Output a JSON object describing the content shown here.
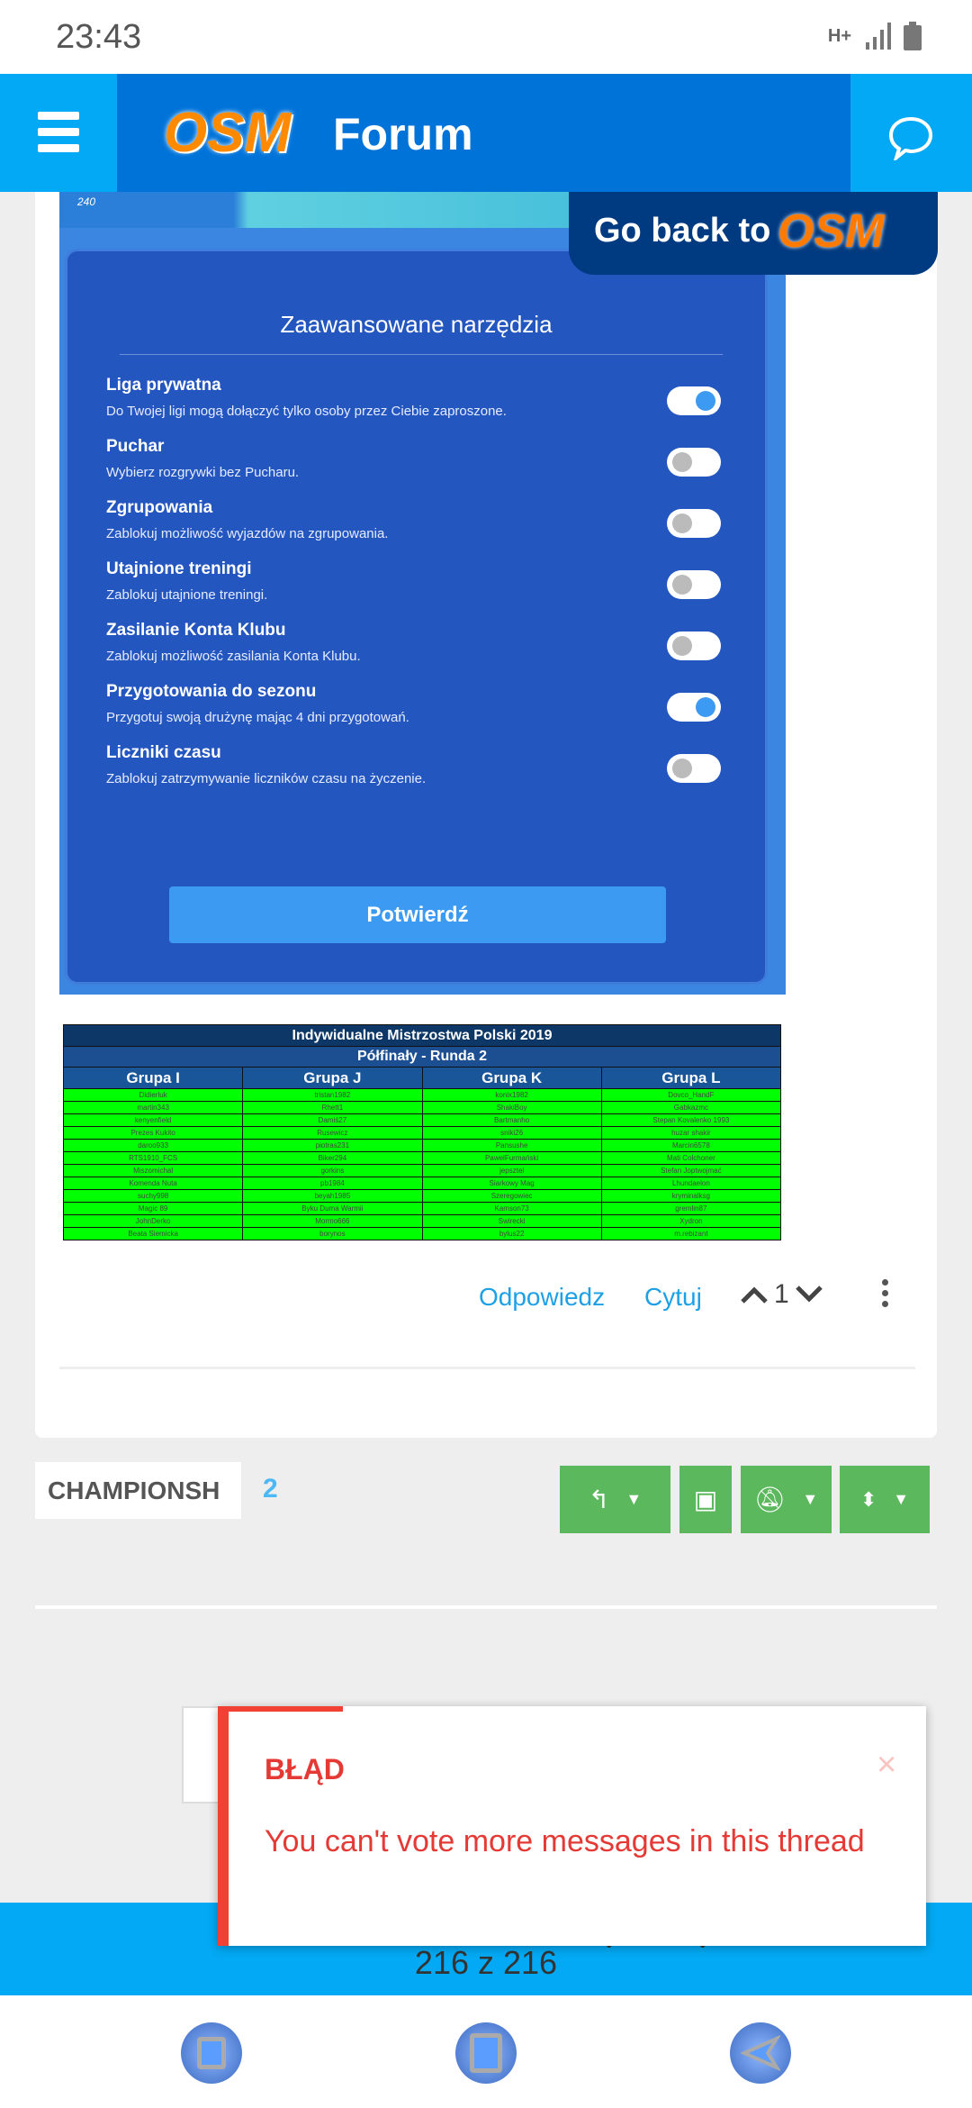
{
  "status": {
    "time": "23:43",
    "network": "H+",
    "icons": [
      "network-type-icon",
      "signal-icon",
      "battery-icon"
    ]
  },
  "header": {
    "logo": "OSM",
    "title": "Forum",
    "icons": [
      "menu-icon",
      "chat-icon"
    ]
  },
  "banner": {
    "go_back": "Go back to",
    "logo": "OSM",
    "strip_value": "240"
  },
  "settings": {
    "title": "Zaawansowane narzędzia",
    "items": [
      {
        "label": "Liga prywatna",
        "desc": "Do Twojej ligi mogą dołączyć tylko osoby przez Ciebie zaproszone.",
        "on": true
      },
      {
        "label": "Puchar",
        "desc": "Wybierz rozgrywki bez Pucharu.",
        "on": false
      },
      {
        "label": "Zgrupowania",
        "desc": "Zablokuj możliwość wyjazdów na zgrupowania.",
        "on": false
      },
      {
        "label": "Utajnione treningi",
        "desc": "Zablokuj utajnione treningi.",
        "on": false
      },
      {
        "label": "Zasilanie Konta Klubu",
        "desc": "Zablokuj możliwość zasilania Konta Klubu.",
        "on": false
      },
      {
        "label": "Przygotowania do sezonu",
        "desc": "Przygotuj swoją drużynę mając 4 dni przygotowań.",
        "on": true
      },
      {
        "label": "Liczniki czasu",
        "desc": "Zablokuj zatrzymywanie liczników czasu na życzenie.",
        "on": false
      }
    ],
    "confirm": "Potwierdź"
  },
  "table": {
    "title": "Indywidualne Mistrzostwa Polski 2019",
    "subtitle": "Półfinały - Runda 2",
    "headers": [
      "Grupa I",
      "Grupa J",
      "Grupa K",
      "Grupa L"
    ],
    "rows": [
      [
        "Didierluk",
        "tristan1982",
        "konix1982",
        "Dovco_HandF"
      ],
      [
        "martin343",
        "Rhett1",
        "ShakiBoy",
        "Gabkazmc"
      ],
      [
        "kenyenfield",
        "Damiś27",
        "Bartmanho",
        "Stepan Kovalenko 1993"
      ],
      [
        "Prezes Kukito",
        "Rusewicz",
        "sniki26",
        "huzar shakir"
      ],
      [
        "daroo933",
        "piotras231",
        "Pansushe",
        "Marcin6578"
      ],
      [
        "RTS1910_FCS",
        "Biker294",
        "PawelFurmański",
        "Mati Colchoner"
      ],
      [
        "Miszomichal",
        "gorkins",
        "jepsztel",
        "Stefan Joptwojmać"
      ],
      [
        "Komenda Nuta",
        "pb1984",
        "Siarkowy Mag",
        "Lhundaelon"
      ],
      [
        "suchy998",
        "beyah1985",
        "Szeregowiec",
        "kryminalksg"
      ],
      [
        "Magic 89",
        "Byku Duma Warmii",
        "Kamson73",
        "gremlin87"
      ],
      [
        "JohnDerko",
        "Mormo666",
        "Swirecki",
        "Xydron"
      ],
      [
        "Beata Siemicka",
        "borynos",
        "bylus22",
        "m.rebizant"
      ]
    ]
  },
  "post_actions": {
    "reply": "Odpowiedz",
    "quote": "Cytuj",
    "votes": "1"
  },
  "thread": {
    "tag": "CHAMPIONSH",
    "count": "2",
    "buttons": [
      "reply-icon",
      "inbox-icon",
      "bell-off-icon",
      "sort-icon"
    ]
  },
  "pager": {
    "text": "216 z 216"
  },
  "toast": {
    "title": "BŁĄD",
    "message": "You can't vote more messages in this thread",
    "close": "×",
    "color": "#e53935"
  },
  "colors": {
    "accent": "#03a9f4",
    "header_center": "#0073d9",
    "panel": "#2456c0",
    "toggle_on": "#3d9af2",
    "table_cells": "#00ff00",
    "action_buttons": "#5cb85c"
  }
}
